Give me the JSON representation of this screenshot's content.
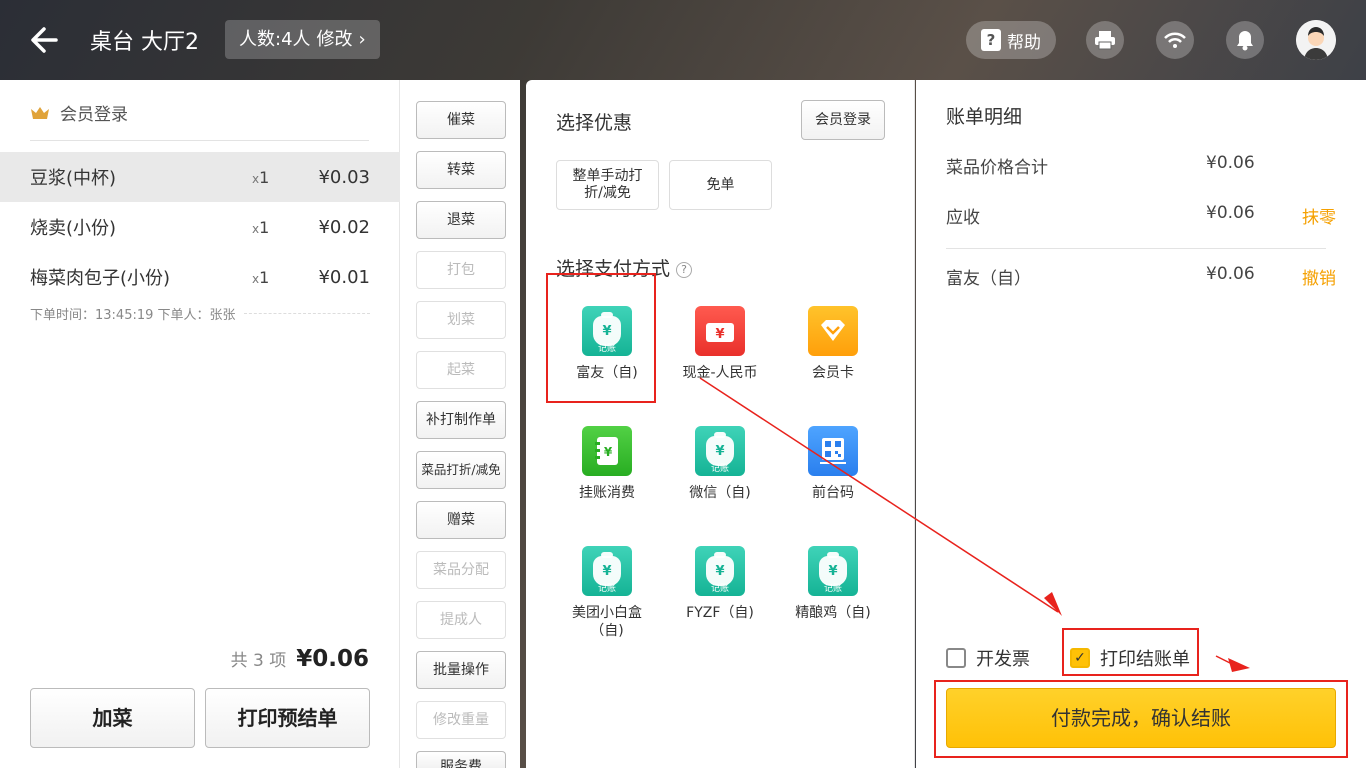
{
  "header": {
    "back_icon": "arrow-left-icon",
    "title": "桌台 大厅2",
    "people_label": "人数:4人",
    "edit_label": "修改",
    "help_label": "帮助",
    "icons": [
      "print-icon",
      "wifi-icon",
      "bell-icon",
      "avatar"
    ]
  },
  "left": {
    "member_login": "会员登录",
    "items": [
      {
        "name": "豆浆(中杯)",
        "qty": "1",
        "price": "¥0.03"
      },
      {
        "name": "烧卖(小份)",
        "qty": "1",
        "price": "¥0.02"
      },
      {
        "name": "梅菜肉包子(小份)",
        "qty": "1",
        "price": "¥0.01"
      }
    ],
    "qty_prefix": "x",
    "order_meta": "下单时间：13:45:19 下单人：张张",
    "count_label": "共 3 项",
    "total": "¥0.06",
    "add_dish": "加菜",
    "print_pre": "打印预结单"
  },
  "actions": [
    {
      "label": "催菜",
      "enabled": true
    },
    {
      "label": "转菜",
      "enabled": true
    },
    {
      "label": "退菜",
      "enabled": true
    },
    {
      "label": "打包",
      "enabled": false
    },
    {
      "label": "划菜",
      "enabled": false
    },
    {
      "label": "起菜",
      "enabled": false
    },
    {
      "label": "补打制作单",
      "enabled": true
    },
    {
      "label": "菜品打折/减免",
      "enabled": true
    },
    {
      "label": "赠菜",
      "enabled": true
    },
    {
      "label": "菜品分配",
      "enabled": false
    },
    {
      "label": "提成人",
      "enabled": false
    },
    {
      "label": "批量操作",
      "enabled": true
    },
    {
      "label": "修改重量",
      "enabled": false
    },
    {
      "label": "服务费",
      "enabled": true
    }
  ],
  "payment": {
    "discount_title": "选择优惠",
    "member_login": "会员登录",
    "discount_whole": "整单手动打折/减免",
    "free_order": "免单",
    "method_title": "选择支付方式",
    "methods": [
      {
        "label": "富友（自)",
        "color": "teal",
        "icon": "money-bag-icon"
      },
      {
        "label": "现金-人民币",
        "color": "red",
        "icon": "cash-wallet-icon"
      },
      {
        "label": "会员卡",
        "color": "orange",
        "icon": "diamond-icon"
      },
      {
        "label": "挂账消费",
        "color": "green",
        "icon": "ledger-icon"
      },
      {
        "label": "微信（自)",
        "color": "teal",
        "icon": "money-bag-icon"
      },
      {
        "label": "前台码",
        "color": "blue",
        "icon": "qr-code-icon"
      },
      {
        "label": "美团小白盒（自)",
        "color": "teal",
        "icon": "money-bag-icon"
      },
      {
        "label": "FYZF（自)",
        "color": "teal",
        "icon": "money-bag-icon"
      },
      {
        "label": "精酿鸡（自)",
        "color": "teal",
        "icon": "money-bag-icon"
      }
    ],
    "bag_tag": "记账"
  },
  "bill": {
    "title": "账单明细",
    "rows": [
      {
        "key": "菜品价格合计",
        "value": "¥0.06",
        "action": ""
      },
      {
        "key": "应收",
        "value": "¥0.06",
        "action": "抹零"
      },
      {
        "key": "富友（自）",
        "value": "¥0.06",
        "action": "撤销"
      }
    ],
    "invoice": "开发票",
    "print_bill": "打印结账单",
    "confirm": "付款完成，确认结账",
    "accent": "#ffc107",
    "highlight_color": "#e8231d"
  }
}
